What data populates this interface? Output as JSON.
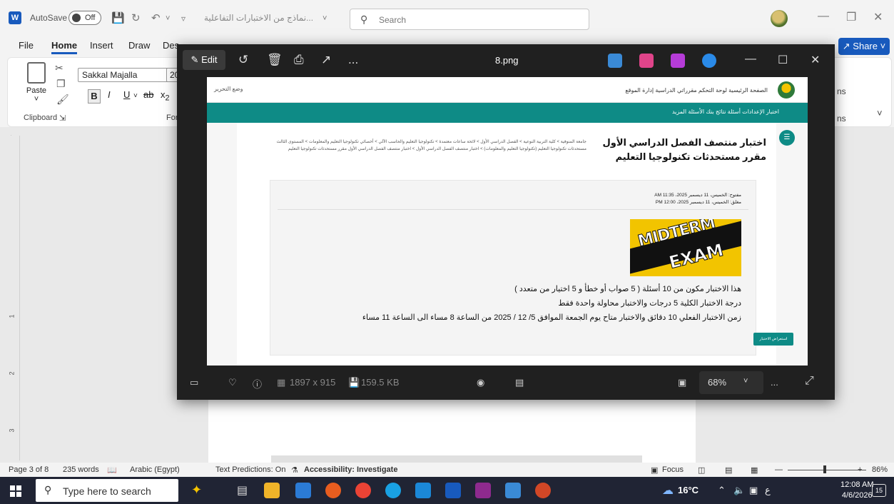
{
  "word": {
    "autosave_label": "AutoSave",
    "autosave_state": "Off",
    "doc_title": "نماذج من الاختبارات التفاعلية...",
    "search_placeholder": "Search",
    "tabs": [
      "File",
      "Home",
      "Insert",
      "Draw",
      "Des"
    ],
    "active_tab": "Home",
    "share_label": "Share",
    "font_name": "Sakkal Majalla",
    "font_size": "20",
    "paste_label": "Paste",
    "clipboard_label": "Clipboard",
    "font_group_partial": "For",
    "ribbon_right_partial": "ns",
    "ribbon_right_partial2": "ns"
  },
  "status": {
    "page": "Page 3 of 8",
    "words": "235 words",
    "language": "Arabic (Egypt)",
    "text_predictions": "Text Predictions: On",
    "accessibility": "Accessibility: Investigate",
    "focus": "Focus",
    "zoom": "86%"
  },
  "taskbar": {
    "search_placeholder": "Type here to search",
    "temperature": "16°C",
    "time": "12:08 AM",
    "date": "4/6/2026",
    "notifications": "15",
    "ime": "ع"
  },
  "viewer": {
    "edit_label": "Edit",
    "file_name": "8.png",
    "dimensions": "1897 x 915",
    "file_size": "159.5 KB",
    "zoom": "68%",
    "more": "..."
  },
  "webpage": {
    "top_nav": "الصفحة الرئيسية   لوحة التحكم   مقرراتي الدراسية   إدارة الموقع",
    "lang_toggle": "وضع التحرير",
    "teal_menu": "اختبار   الإعدادات   أسئلة   نتائج   بنك الأسئلة   المزيد",
    "title": "اختبار منتصف الفصل الدراسي الأول مقرر مستحدثات تكنولوجيا التعليم",
    "breadcrumb_1": "جامعة المنوفية  >  كلية التربية النوعية  >  الفصل الدراسي الأول  >  لائحة ساعات معتمدة  >  تكنولوجيا التعليم والحاسب الآلي  >  أخصائي تكنولوجيا التعليم والمعلومات  >  المستوى الثالث",
    "breadcrumb_2": "مستحدثات تكنولوجيا التعليم (تكنولوجيا التعليم والمعلومات)  >  اختبار منتصف الفصل الدراسي الأول  >  اختبار منتصف الفصل الدراسي الأول مقرر مستحدثات تكنولوجيا التعليم",
    "opened": "مفتوح: الخميس، 11 ديسمبر 2025، 11:35 AM",
    "closes": "مغلق: الخميس، 11 ديسمبر 2025، 12:00 PM",
    "image_text_1": "MIDTERM",
    "image_text_2": "EXAM",
    "line_1": "هذا الاختبار مكون من 10 أسئلة  ( 5 صواب أو خطأ و 5 اختيار من متعدد )",
    "line_2": "درجة الاختبار الكلية 5 درجات والاختبار محاولة واحدة فقط",
    "line_3": "زمن الاختبار الفعلي 10 دقائق والاختبار متاح يوم الجمعة الموافق 5/ 12 / 2025 من الساعة 8 مساء الى الساعة 11 مساء",
    "preview_button": "استعراض الاختبار"
  },
  "colors": {
    "word_blue": "#185abd",
    "teal": "#0e8b86",
    "viewer_bg": "#202020",
    "taskbar": "#202434"
  }
}
